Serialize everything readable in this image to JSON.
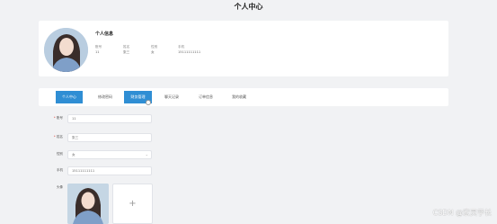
{
  "page": {
    "title": "个人中心"
  },
  "profile": {
    "card_title": "个人信息",
    "fields": [
      {
        "label": "账号",
        "value": "11"
      },
      {
        "label": "姓名",
        "value": "张三"
      },
      {
        "label": "性别",
        "value": "女"
      },
      {
        "label": "手机",
        "value": "15111111111"
      }
    ]
  },
  "tabs": [
    {
      "label": "个人中心",
      "active": true
    },
    {
      "label": "修改密码",
      "active": false
    },
    {
      "label": "财务管理",
      "active": true
    },
    {
      "label": "聊天记录",
      "active": false
    },
    {
      "label": "订单信息",
      "active": false
    },
    {
      "label": "我的收藏",
      "active": false
    }
  ],
  "form": {
    "account": {
      "label": "账号",
      "value": "11",
      "required": true
    },
    "name": {
      "label": "姓名",
      "value": "张三",
      "required": true
    },
    "gender": {
      "label": "性别",
      "value": "女",
      "required": false
    },
    "phone": {
      "label": "手机",
      "value": "15111111111",
      "required": false
    },
    "avatar": {
      "label": "头像",
      "add_symbol": "+"
    }
  },
  "watermark": "CSDN @宏灵学长",
  "colors": {
    "accent": "#2f8ed4",
    "required": "#e0473a",
    "background": "#f1f2f4"
  }
}
